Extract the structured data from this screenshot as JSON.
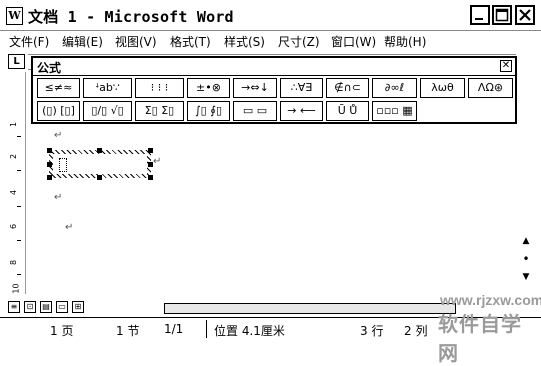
{
  "window": {
    "app_icon_letter": "W",
    "title": "文档 1 - Microsoft Word"
  },
  "menu": [
    "文件(F)",
    "编辑(E)",
    "视图(V)",
    "格式(T)",
    "样式(S)",
    "尺寸(Z)",
    "窗口(W)",
    "帮助(H)"
  ],
  "ruler": {
    "corner": "L",
    "vertical_numbers": [
      "1",
      "2",
      "4",
      "6",
      "8",
      "10"
    ]
  },
  "equation_toolbar": {
    "title": "公式",
    "close_glyph": "✕",
    "row1": [
      "≤≠≈",
      "ꜜab∵",
      "⁝ ⁝ ⁝",
      "±•⊗",
      "→⇔↓",
      "∴∀∃",
      "∉∩⊂",
      "∂∞ℓ",
      "λωθ",
      "ΛΩ⊛"
    ],
    "row2": [
      "(▯) [▯]",
      "▯/▯ √▯",
      "Σ▯ Σ▯",
      "∫▯ ∮▯",
      "▭ ▭",
      "→ ⟵",
      "Ū Ů",
      "▫▫▫ ▦"
    ]
  },
  "document": {
    "para_mark": "↵",
    "equation_cursor": "ꜜ"
  },
  "scroll_buttons": [
    "▲",
    "•",
    "▼"
  ],
  "view_buttons": [
    "≡",
    "⊡",
    "▤",
    "▭",
    "⊞"
  ],
  "status": {
    "page": "1 页",
    "section": "1 节",
    "page_of": "1/1",
    "position": "位置 4.1厘米",
    "line": "3 行",
    "column": "2 列"
  },
  "watermark": {
    "url": "www.rjzxw.com",
    "cn": "软件自学网"
  }
}
